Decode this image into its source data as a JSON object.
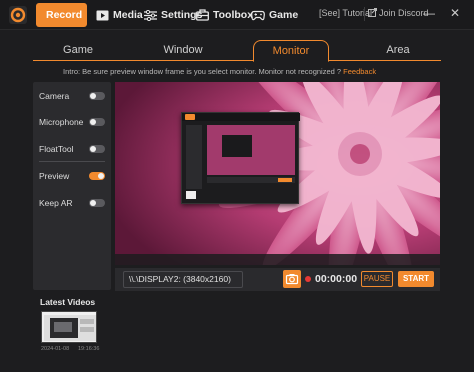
{
  "nav": {
    "items": [
      {
        "label": "Record",
        "icon": "record-icon"
      },
      {
        "label": "Media",
        "icon": "media-icon"
      },
      {
        "label": "Settings",
        "icon": "settings-icon"
      },
      {
        "label": "Toolbox",
        "icon": "toolbox-icon"
      },
      {
        "label": "Game",
        "icon": "gamepad-icon"
      }
    ],
    "active": "Record"
  },
  "top_links": {
    "tutorial": "[See] Tutorial",
    "discord": "Join Discord"
  },
  "tabs": [
    {
      "label": "Game"
    },
    {
      "label": "Window"
    },
    {
      "label": "Monitor"
    },
    {
      "label": "Area"
    }
  ],
  "active_tab": "Monitor",
  "intro": {
    "text": "Intro: Be sure preview window frame is you select monitor. Monitor not recognized ?",
    "link": "Feedback"
  },
  "options": [
    {
      "label": "Camera",
      "on": false
    },
    {
      "label": "Microphone",
      "on": false
    },
    {
      "label": "FloatTool",
      "on": false
    },
    {
      "label": "Preview",
      "on": true
    },
    {
      "label": "Keep AR",
      "on": false
    }
  ],
  "controls": {
    "display": "\\\\.\\DISPLAY2: (3840x2160)",
    "timer": "00:00:00",
    "pause": "PAUSE",
    "start": "START"
  },
  "latest": {
    "title": "Latest Videos",
    "items": [
      {
        "date": "2024-01-08",
        "time": "19:16:36"
      }
    ]
  },
  "colors": {
    "accent": "#f28a2e",
    "background": "#1d1d1f",
    "panel": "#2b2b2e",
    "record_dot": "#e53935"
  }
}
